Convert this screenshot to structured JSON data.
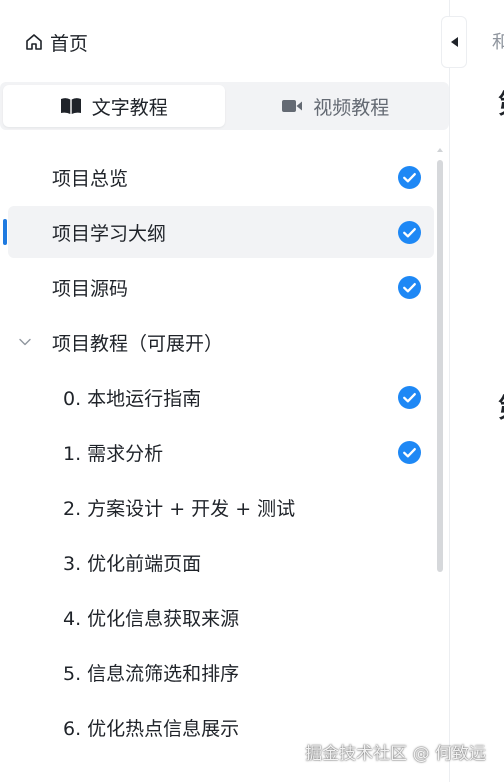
{
  "home": {
    "label": "首页"
  },
  "tabs": [
    {
      "label": "文字教程",
      "icon": "book-icon",
      "active": true
    },
    {
      "label": "视频教程",
      "icon": "video-icon",
      "active": false
    }
  ],
  "menu": {
    "items": [
      {
        "label": "项目总览",
        "completed": true
      },
      {
        "label": "项目学习大纲",
        "completed": true,
        "selected": true
      },
      {
        "label": "项目源码",
        "completed": true
      },
      {
        "label": "项目教程（可展开）",
        "expanded": true
      }
    ],
    "children": [
      {
        "label": "0. 本地运行指南",
        "completed": true
      },
      {
        "label": "1. 需求分析",
        "completed": true
      },
      {
        "label": "2. 方案设计 + 开发 + 测试",
        "completed": false
      },
      {
        "label": "3. 优化前端页面",
        "completed": false
      },
      {
        "label": "4. 优化信息获取来源",
        "completed": false
      },
      {
        "label": "5. 信息流筛选和排序",
        "completed": false
      },
      {
        "label": "6. 优化热点信息展示",
        "completed": false
      }
    ]
  },
  "content": {
    "breadcrumb_fragment": "和",
    "heading_fragment_1": "第",
    "heading_fragment_2": "第"
  },
  "watermark": "掘金技术社区 @ 何致远",
  "colors": {
    "accent": "#1f7ae0",
    "check": "#1e88f5",
    "selected_bg": "#f2f3f5",
    "text": "#1f2329",
    "muted": "#646a73"
  }
}
